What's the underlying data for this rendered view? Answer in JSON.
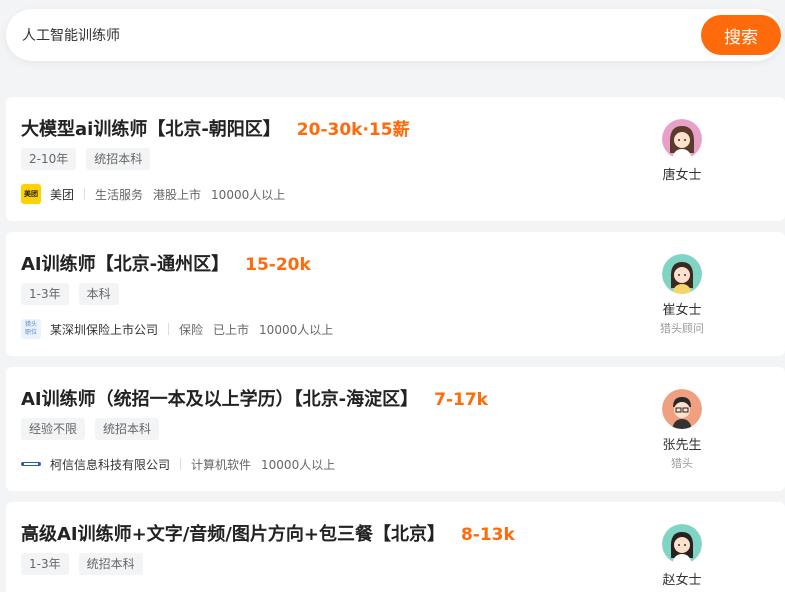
{
  "search": {
    "value": "人工智能训练师",
    "button_label": "搜索"
  },
  "jobs": [
    {
      "title": "大模型ai训练师【北京-朝阳区】",
      "salary": "20-30k·15薪",
      "tags": [
        "2-10年",
        "统招本科"
      ],
      "company": "美团",
      "logo_text": "美团",
      "meta": [
        "生活服务",
        "港股上市",
        "10000人以上"
      ],
      "recruiter": {
        "name": "唐女士",
        "role": ""
      }
    },
    {
      "title": "AI训练师【北京-通州区】",
      "salary": "15-20k",
      "tags": [
        "1-3年",
        "本科"
      ],
      "company": "某深圳保险上市公司",
      "logo_text": "猎头\n职位",
      "meta": [
        "保险",
        "已上市",
        "10000人以上"
      ],
      "recruiter": {
        "name": "崔女士",
        "role": "猎头顾问"
      }
    },
    {
      "title": "AI训练师（统招一本及以上学历）【北京-海淀区】",
      "salary": "7-17k",
      "tags": [
        "经验不限",
        "统招本科"
      ],
      "company": "柯信信息科技有限公司",
      "logo_text": "",
      "meta": [
        "计算机软件",
        "10000人以上"
      ],
      "recruiter": {
        "name": "张先生",
        "role": "猎头"
      }
    },
    {
      "title": "高级AI训练师+文字/音频/图片方向+包三餐【北京】",
      "salary": "8-13k",
      "tags": [
        "1-3年",
        "统招本科"
      ],
      "company": "",
      "logo_text": "",
      "meta": [],
      "recruiter": {
        "name": "赵女士",
        "role": ""
      }
    }
  ],
  "colors": {
    "accent": "#ff6a0a",
    "background": "#f3f4f6"
  }
}
